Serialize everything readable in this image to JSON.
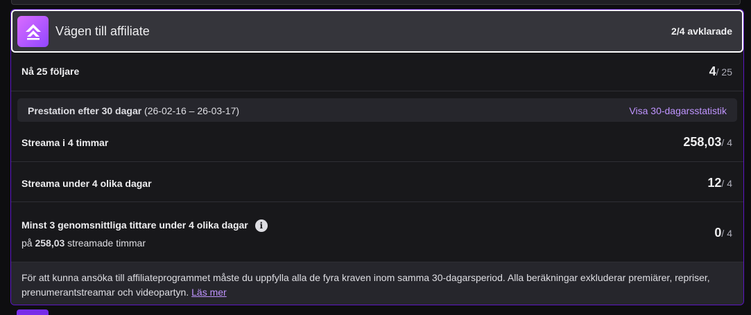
{
  "header": {
    "title": "Vägen till affiliate",
    "progress": "2/4 avklarade",
    "badge_icon": "affiliate-arrow-icon",
    "accent": "#9147ff"
  },
  "followers": {
    "label": "Nå 25 följare",
    "current": "4",
    "target": "/ 25"
  },
  "period": {
    "label_bold": "Prestation efter 30 dagar",
    "range": " (26-02-16 – 26-03-17)",
    "link": "Visa 30-dagarsstatistik"
  },
  "requirements": [
    {
      "label": "Streama i 4 timmar",
      "current": "258,03",
      "target": "/ 4"
    },
    {
      "label": "Streama under 4 olika dagar",
      "current": "12",
      "target": "/ 4"
    },
    {
      "label": "Minst 3 genomsnittliga tittare under 4 olika dagar",
      "current": "0",
      "target": "/ 4",
      "info_icon": "info-icon",
      "sub_prefix": "på ",
      "sub_bold": "258,03",
      "sub_suffix": " streamade timmar"
    }
  ],
  "footer": {
    "text": "För att kunna ansöka till affiliateprogrammet måste du uppfylla alla de fyra kraven inom samma 30-dagarsperiod. Alla beräkningar exkluderar premiärer, repriser, prenumerantstreamar och videopartyn. ",
    "link": "Läs mer"
  }
}
